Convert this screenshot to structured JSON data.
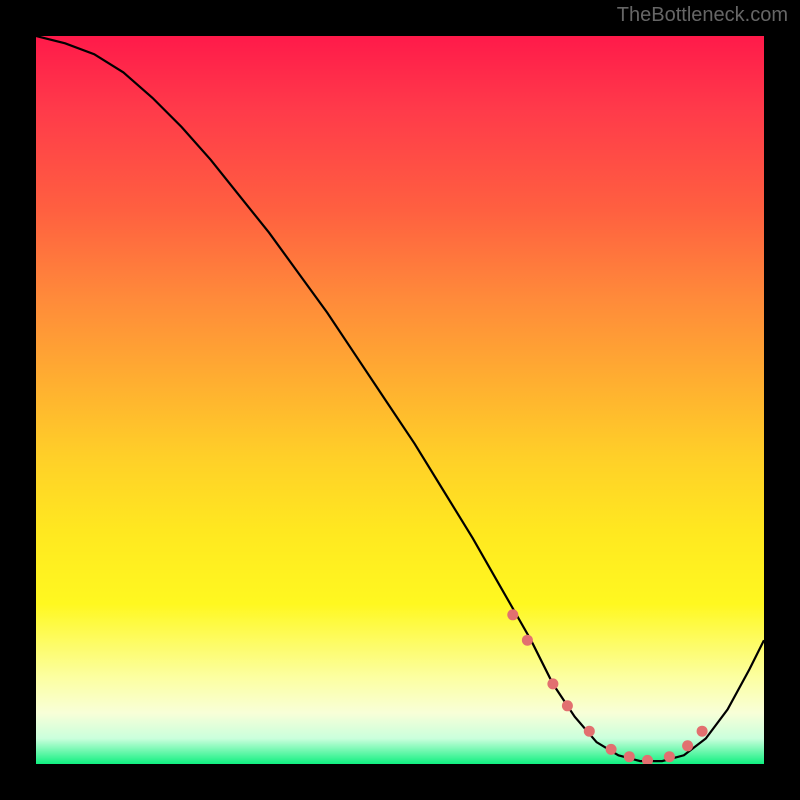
{
  "watermark": "TheBottleneck.com",
  "chart_data": {
    "type": "line",
    "title": "",
    "xlabel": "",
    "ylabel": "",
    "xlim": [
      0,
      100
    ],
    "ylim": [
      0,
      100
    ],
    "series": [
      {
        "name": "curve",
        "x": [
          0,
          4,
          8,
          12,
          16,
          20,
          24,
          28,
          32,
          36,
          40,
          44,
          48,
          52,
          56,
          60,
          64,
          68,
          71,
          74,
          77,
          80,
          83,
          86,
          89,
          92,
          95,
          98,
          100
        ],
        "values": [
          100,
          99,
          97.5,
          95,
          91.5,
          87.5,
          83,
          78,
          73,
          67.5,
          62,
          56,
          50,
          44,
          37.5,
          31,
          24,
          17,
          11,
          6.5,
          3,
          1.2,
          0.4,
          0.4,
          1.2,
          3.5,
          7.5,
          13,
          17
        ],
        "color": "#000000"
      }
    ],
    "dots": {
      "x": [
        65.5,
        67.5,
        71,
        73,
        76,
        79,
        81.5,
        84,
        87,
        89.5,
        91.5
      ],
      "y": [
        20.5,
        17,
        11,
        8,
        4.5,
        2,
        1,
        0.5,
        1,
        2.5,
        4.5
      ],
      "color": "#e27070"
    },
    "gradient_stops": [
      {
        "pct": 0,
        "color": "#ff1a4a"
      },
      {
        "pct": 24,
        "color": "#ff6040"
      },
      {
        "pct": 48,
        "color": "#ffb030"
      },
      {
        "pct": 68,
        "color": "#ffe820"
      },
      {
        "pct": 88,
        "color": "#fcffa0"
      },
      {
        "pct": 96.5,
        "color": "#caffdc"
      },
      {
        "pct": 100,
        "color": "#10f080"
      }
    ]
  }
}
